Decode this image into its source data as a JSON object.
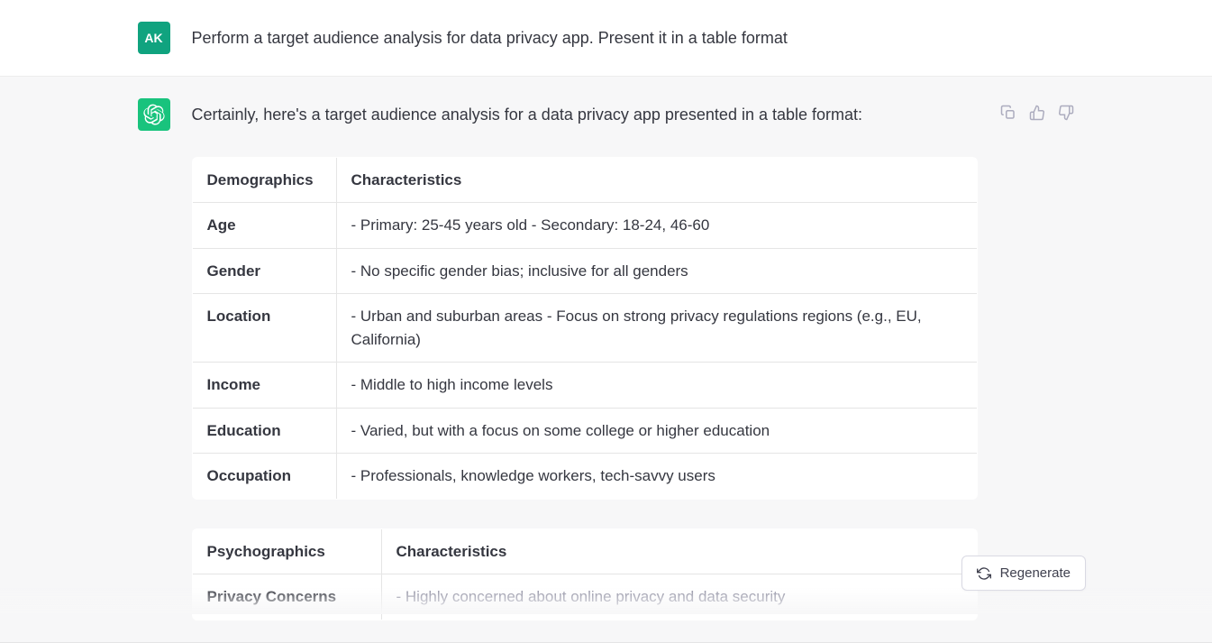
{
  "user": {
    "avatar_initials": "AK",
    "message": "Perform a target audience analysis for data privacy app. Present it in a table format"
  },
  "assistant": {
    "intro": "Certainly, here's a target audience analysis for a data privacy app presented in a table format:",
    "table1": {
      "header": {
        "c1": "Demographics",
        "c2": "Characteristics"
      },
      "rows": [
        {
          "c1": "Age",
          "c2": "- Primary: 25-45 years old - Secondary: 18-24, 46-60"
        },
        {
          "c1": "Gender",
          "c2": "- No specific gender bias; inclusive for all genders"
        },
        {
          "c1": "Location",
          "c2": "- Urban and suburban areas - Focus on strong privacy regulations regions (e.g., EU, California)"
        },
        {
          "c1": "Income",
          "c2": "- Middle to high income levels"
        },
        {
          "c1": "Education",
          "c2": "- Varied, but with a focus on some college or higher education"
        },
        {
          "c1": "Occupation",
          "c2": "- Professionals, knowledge workers, tech-savvy users"
        }
      ]
    },
    "table2": {
      "header": {
        "c1": "Psychographics",
        "c2": "Characteristics"
      },
      "rows": [
        {
          "c1": "Privacy Concerns",
          "c2": "- Highly concerned about online privacy and data security"
        }
      ]
    }
  },
  "actions": {
    "copy": "copy",
    "thumbs_up": "thumbs-up",
    "thumbs_down": "thumbs-down",
    "regenerate_label": "Regenerate"
  }
}
